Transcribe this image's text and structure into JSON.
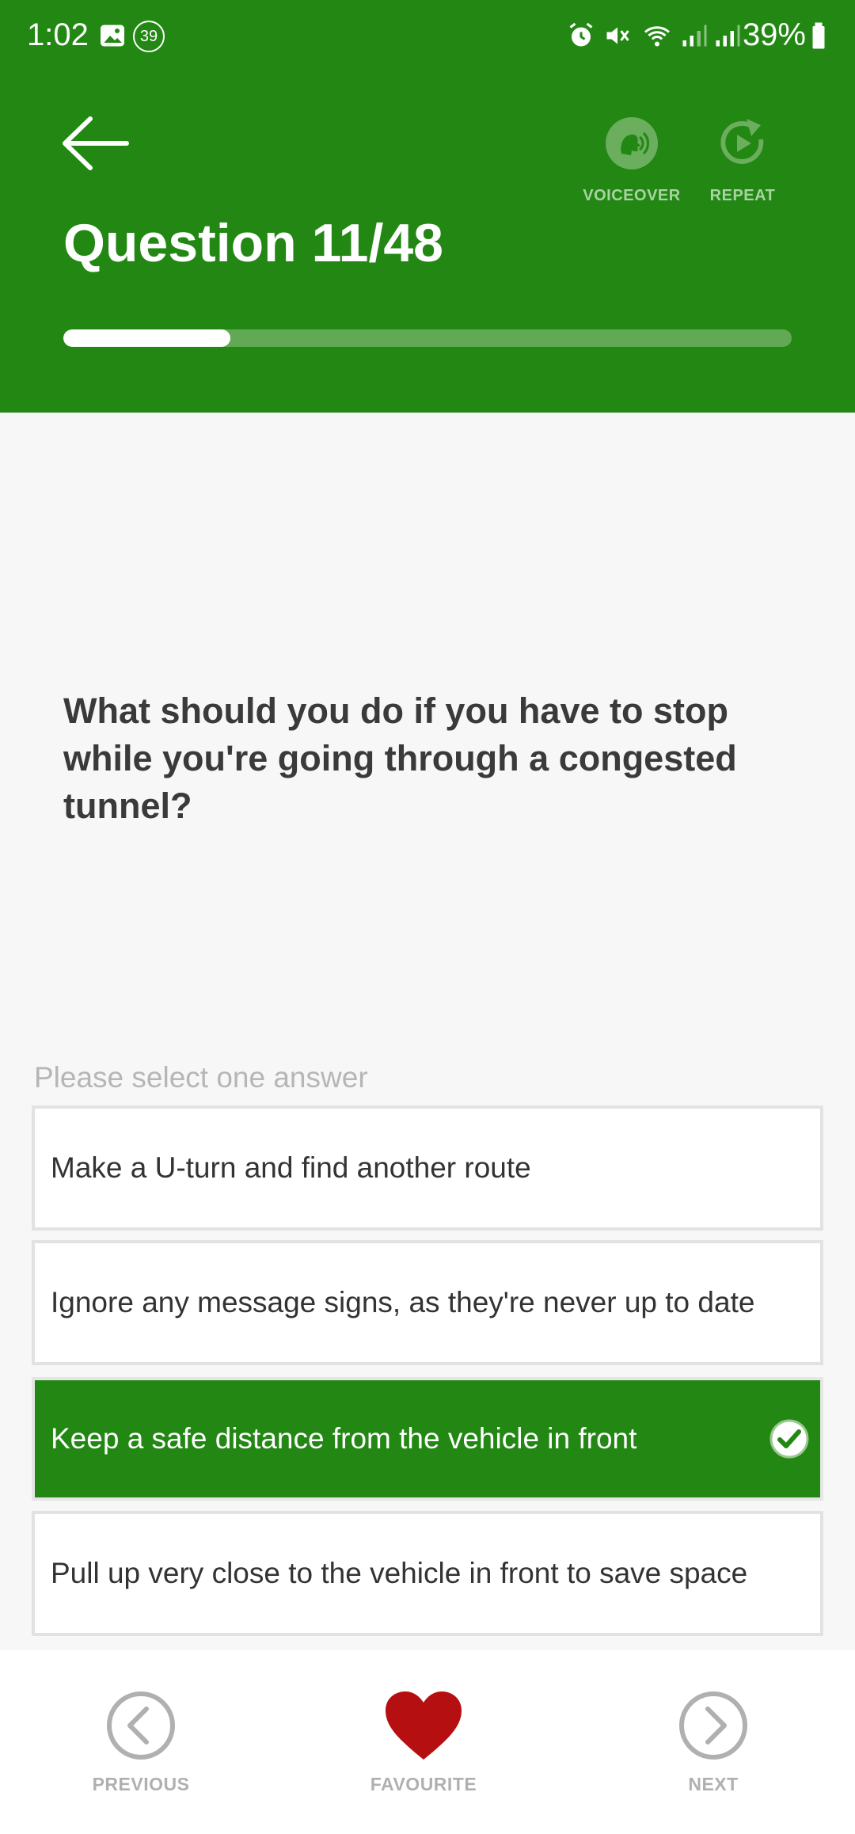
{
  "status_bar": {
    "time": "1:02",
    "notification_count": "39",
    "battery_percent": "39%"
  },
  "header": {
    "question_counter": "Question 11/48",
    "voiceover_label": "VOICEOVER",
    "repeat_label": "REPEAT",
    "progress_fraction": 0.229,
    "background_color": "#228713"
  },
  "question": {
    "text": "What should you do if you have to stop while you're going through a congested tunnel?",
    "hint": "Please select one answer"
  },
  "answers": [
    {
      "text": "Make a U-turn and find another route",
      "selected": false
    },
    {
      "text": "Ignore any message signs, as they're never up to date",
      "selected": false
    },
    {
      "text": "Keep a safe distance from the vehicle in front",
      "selected": true
    },
    {
      "text": "Pull up very close to the vehicle in front to save space",
      "selected": false
    }
  ],
  "footer": {
    "previous_label": "PREVIOUS",
    "favourite_label": "FAVOURITE",
    "next_label": "NEXT",
    "favourite_color": "#b50f11"
  },
  "icons": [
    "image-icon",
    "alarm-icon",
    "mute-icon",
    "wifi-icon",
    "signal-icon",
    "battery-icon",
    "back-arrow-icon",
    "voiceover-icon",
    "repeat-icon",
    "check-icon",
    "chevron-left-icon",
    "heart-icon",
    "chevron-right-icon"
  ]
}
